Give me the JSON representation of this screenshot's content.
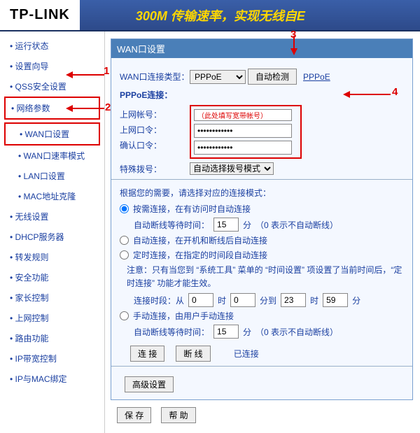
{
  "header": {
    "logo": "TP-LINK",
    "slogan": "300M 传输速率，实现无线自E"
  },
  "sidebar": {
    "items": [
      {
        "label": "运行状态"
      },
      {
        "label": "设置向导"
      },
      {
        "label": "QSS安全设置"
      },
      {
        "label": "网络参数"
      },
      {
        "label": "WAN口设置"
      },
      {
        "label": "WAN口速率模式"
      },
      {
        "label": "LAN口设置"
      },
      {
        "label": "MAC地址克隆"
      },
      {
        "label": "无线设置"
      },
      {
        "label": "DHCP服务器"
      },
      {
        "label": "转发规则"
      },
      {
        "label": "安全功能"
      },
      {
        "label": "家长控制"
      },
      {
        "label": "上网控制"
      },
      {
        "label": "路由功能"
      },
      {
        "label": "IP带宽控制"
      },
      {
        "label": "IP与MAC绑定"
      }
    ]
  },
  "annotations": {
    "a1": "1",
    "a2": "2",
    "a3": "3",
    "a4": "4"
  },
  "panel": {
    "title": "WAN口设置",
    "conn_type_label": "WAN口连接类型：",
    "conn_type_value": "PPPoE",
    "auto_detect": "自动检测",
    "pppoe_link": "PPPoE",
    "sub_title": "PPPoE连接：",
    "account_label": "上网帐号：",
    "account_value": "（此处填写宽带帐号）",
    "password_label": "上网口令：",
    "password_value": "************",
    "confirm_label": "确认口令：",
    "confirm_value": "************",
    "special_dial_label": "特殊拨号：",
    "special_dial_value": "自动选择拨号模式",
    "mode_hint": "根据您的需要，请选择对应的连接模式：",
    "mode_on_demand": "按需连接，在有访问时自动连接",
    "idle_label": "自动断线等待时间：",
    "idle_value": "15",
    "minute": "分",
    "idle_note": "（0 表示不自动断线）",
    "mode_auto": "自动连接，在开机和断线后自动连接",
    "mode_timed": "定时连接，在指定的时间段自动连接",
    "timed_note": "注意：只有当您到 “系统工具” 菜单的 “时间设置” 项设置了当前时间后，“定时连接” 功能才能生效。",
    "period_label": "连接时段：从",
    "from_h": "0",
    "from_m": "0",
    "h": "时",
    "m": "分到",
    "to_h": "23",
    "to": "时",
    "to_m": "59",
    "to_min": "分",
    "mode_manual": "手动连接，由用户手动连接",
    "idle2_value": "15",
    "connect_btn": "连 接",
    "disconnect_btn": "断 线",
    "status": "已连接",
    "advanced": "高级设置",
    "save": "保 存",
    "help": "帮 助"
  }
}
